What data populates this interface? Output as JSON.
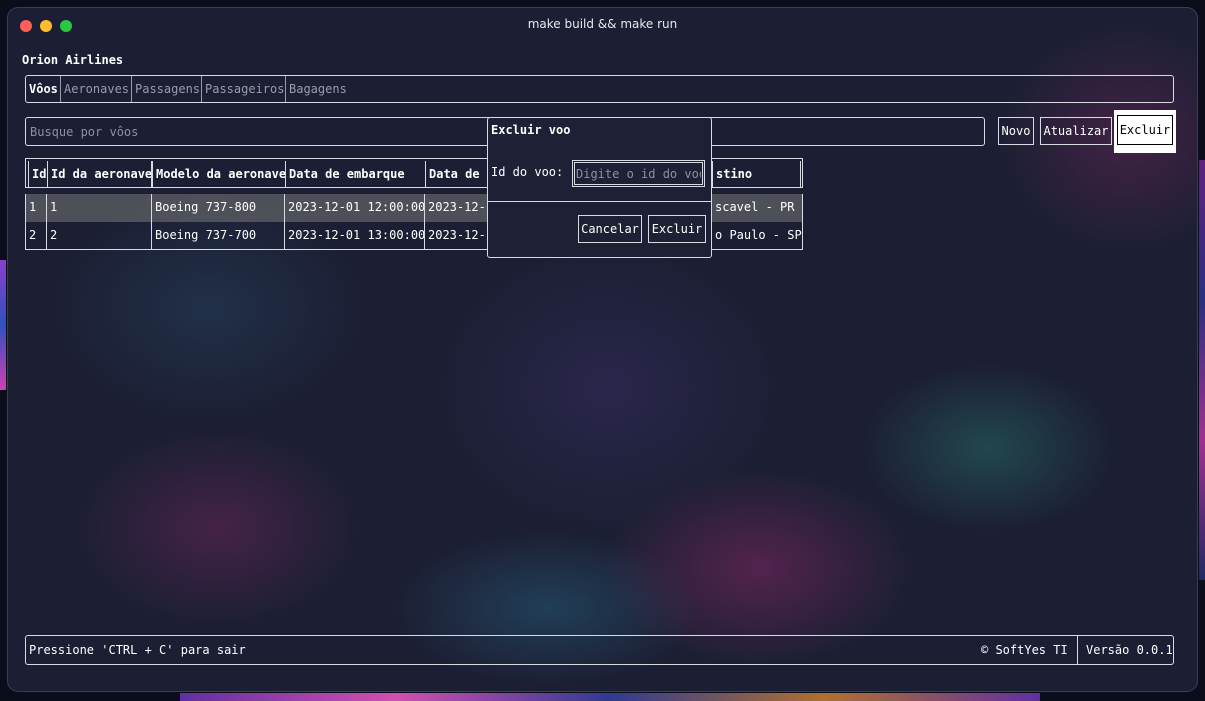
{
  "window": {
    "title": "make build && make run"
  },
  "app": {
    "title": "Orion Airlines"
  },
  "tabs": [
    {
      "label": "Vôos",
      "active": true
    },
    {
      "label": "Aeronaves",
      "active": false
    },
    {
      "label": "Passagens",
      "active": false
    },
    {
      "label": "Passageiros",
      "active": false
    },
    {
      "label": "Bagagens",
      "active": false
    }
  ],
  "toolbar": {
    "search_placeholder": "Busque por vôos",
    "new_label": "Novo",
    "refresh_label": "Atualizar",
    "delete_label": "Excluir"
  },
  "table": {
    "columns": [
      "Id",
      "Id da aeronave",
      "Modelo da aeronave",
      "Data de embarque",
      "Data de",
      "stino"
    ],
    "rows": [
      [
        "1",
        "1",
        "Boeing 737-800",
        "2023-12-01 12:00:00",
        "2023-12-",
        "scavel - PR"
      ],
      [
        "2",
        "2",
        "Boeing 737-700",
        "2023-12-01 13:00:00",
        "2023-12-",
        "o Paulo - SP"
      ]
    ]
  },
  "dialog": {
    "title": "Excluir voo",
    "field_label": "Id do voo:",
    "field_placeholder": "Digite o id do voo",
    "cancel_label": "Cancelar",
    "confirm_label": "Excluir"
  },
  "footer": {
    "hint": "Pressione 'CTRL + C' para sair",
    "company": "© SoftYes TI",
    "version": "Versão 0.0.1"
  },
  "colors": {
    "background": "#1c1f34",
    "border": "#d9dbe4",
    "muted_text": "#9a9cab",
    "selected_row": "#5a5a5a"
  }
}
